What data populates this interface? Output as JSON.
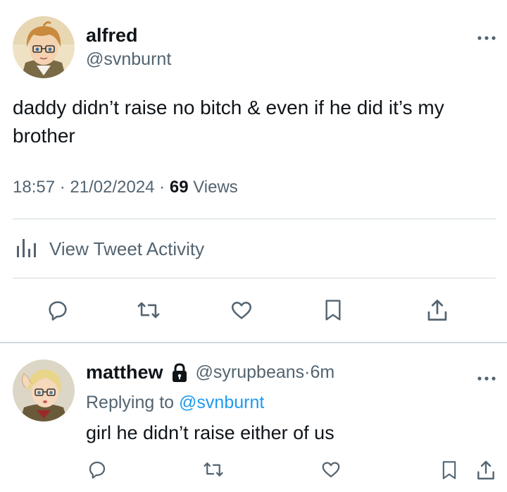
{
  "main_tweet": {
    "author": {
      "name": "alfred",
      "handle": "@svnburnt"
    },
    "text": "daddy didn’t raise no bitch & even if he did it’s my brother",
    "time": "18:57",
    "separator1": " · ",
    "date": "21/02/2024",
    "separator2": " · ",
    "views_count": "69",
    "views_label": " Views",
    "activity_label": "View Tweet Activity",
    "icons": [
      "more-icon",
      "analytics-icon",
      "reply-icon",
      "retweet-icon",
      "like-icon",
      "bookmark-icon",
      "share-icon"
    ]
  },
  "reply_tweet": {
    "author": {
      "name": "matthew",
      "handle": "@syrupbeans",
      "protected": true
    },
    "separator": " · ",
    "time": "6m",
    "replying_prefix": "Replying to ",
    "replying_to": "@svnburnt",
    "text": "girl he didn’t raise either of us",
    "icons": [
      "more-icon",
      "lock-icon",
      "reply-icon",
      "retweet-icon",
      "like-icon",
      "bookmark-icon",
      "share-icon"
    ]
  },
  "colors": {
    "text_primary": "#0f1419",
    "text_secondary": "#536471",
    "link": "#1d9bf0",
    "border": "#cfd9de",
    "background": "#ffffff"
  }
}
